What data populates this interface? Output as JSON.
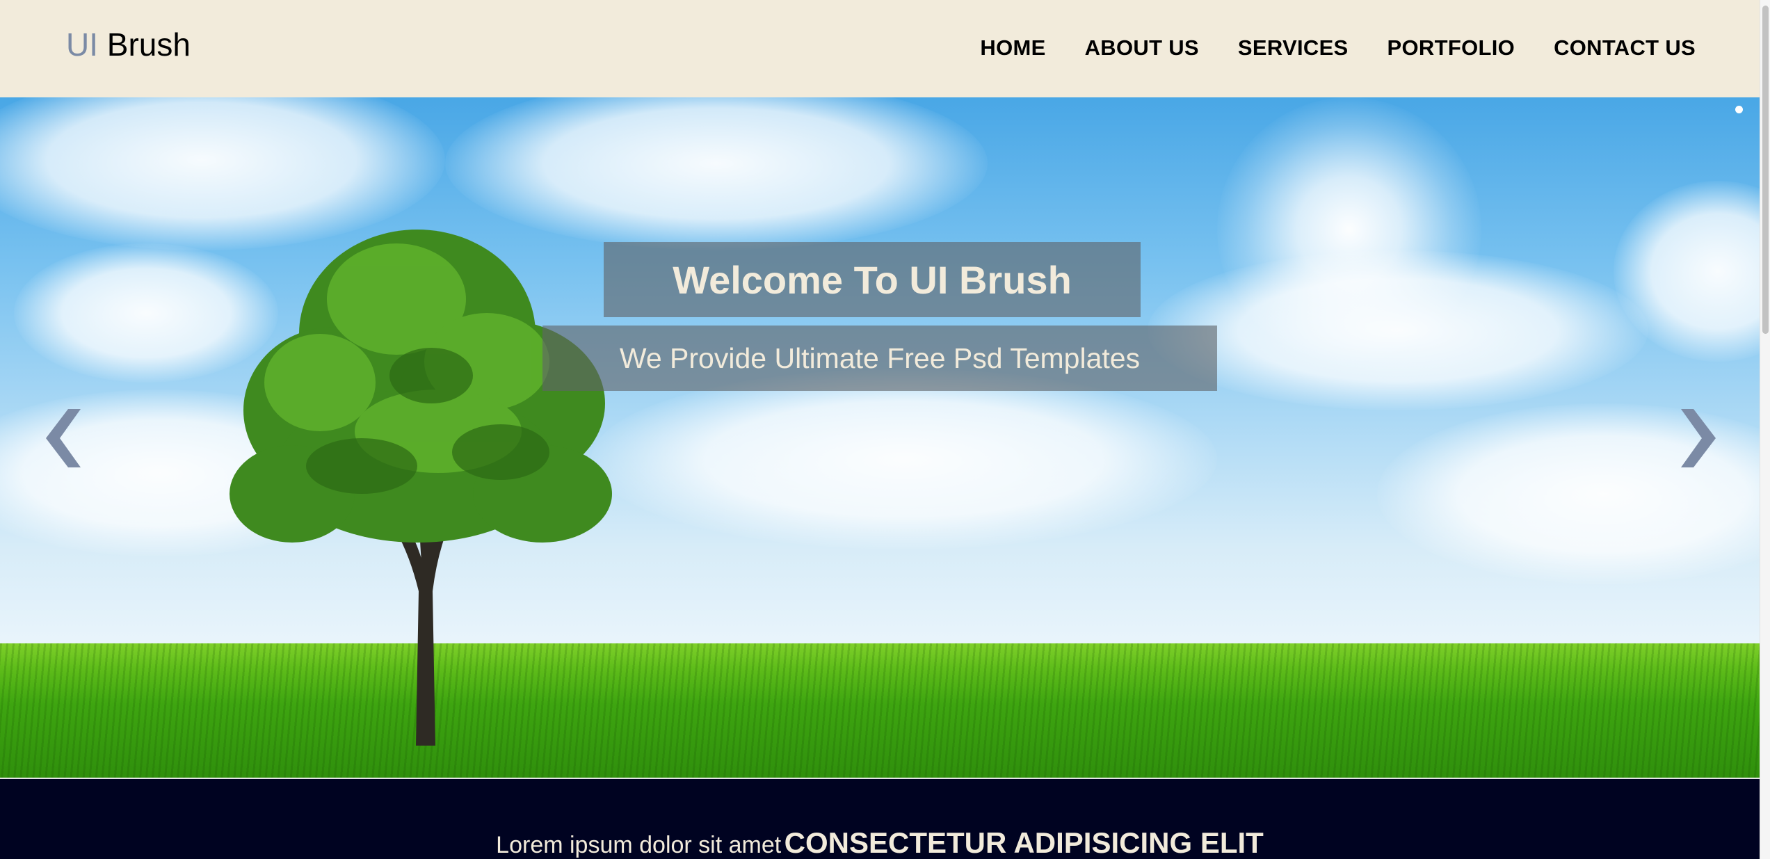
{
  "header": {
    "logo_accent": "UI",
    "logo_rest": "Brush",
    "nav": [
      {
        "label": "HOME"
      },
      {
        "label": "ABOUT US"
      },
      {
        "label": "SERVICES"
      },
      {
        "label": "PORTFOLIO"
      },
      {
        "label": "CONTACT US"
      }
    ]
  },
  "hero": {
    "title": "Welcome To UI Brush",
    "subtitle": "We Provide Ultimate Free Psd Templates",
    "prev_icon": "chevron-left-icon",
    "next_icon": "chevron-right-icon"
  },
  "band": {
    "plain_text": "Lorem ipsum dolor sit amet",
    "strong_text": "CONSECTETUR ADIPISICING ELIT"
  },
  "colors": {
    "header_bg": "#f2ebdb",
    "logo_accent": "#7b8aa5",
    "caption_text": "#f2ebdb",
    "band_bg": "#000321",
    "arrow": "#7b8aa5"
  }
}
